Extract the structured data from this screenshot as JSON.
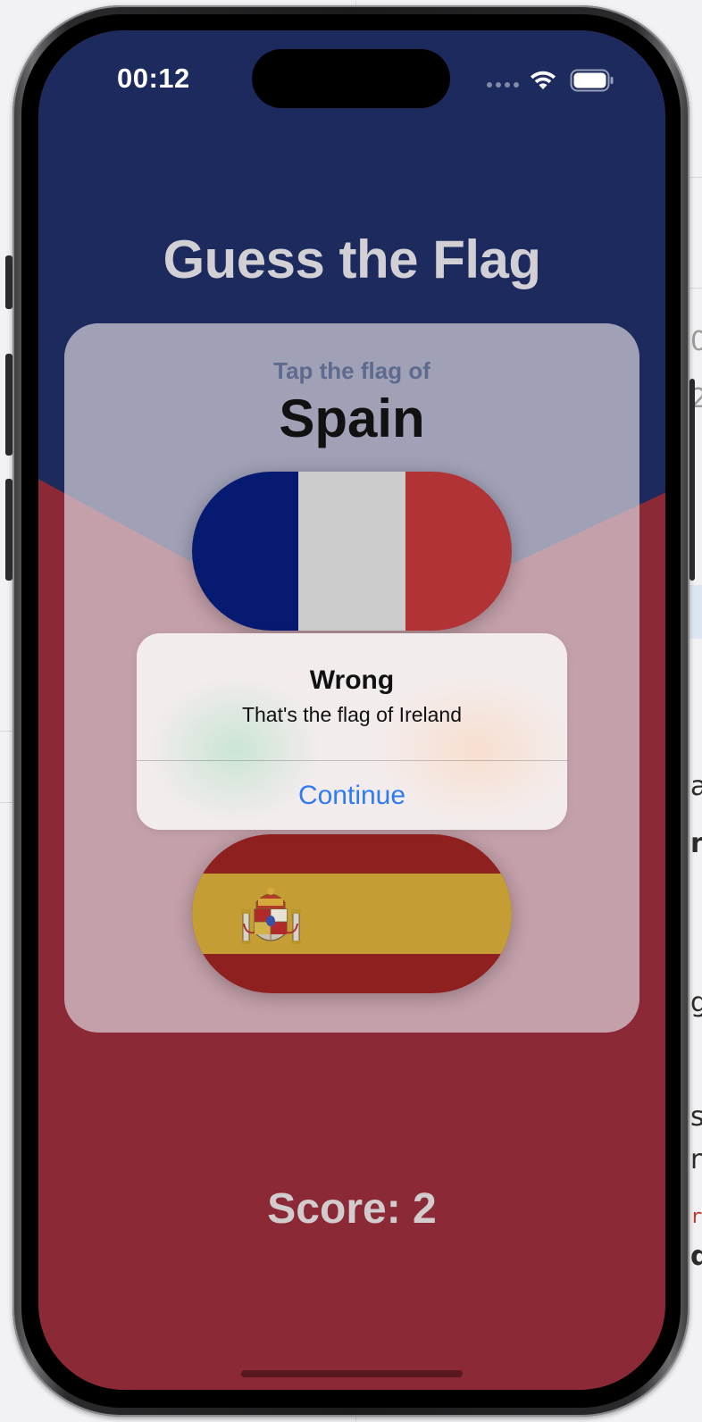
{
  "status_bar": {
    "time": "00:12"
  },
  "app": {
    "title": "Guess the Flag",
    "prompt_label": "Tap the flag of",
    "target_country": "Spain",
    "score_text": "Score: 2"
  },
  "flags": [
    {
      "country": "France",
      "colors": [
        "#071a72",
        "#cccccc",
        "#b13335"
      ]
    },
    {
      "country": "Spain",
      "colors": [
        "#8f2020",
        "#c49e34",
        "#8f2020"
      ]
    }
  ],
  "alert": {
    "title": "Wrong",
    "message": "That's the flag of Ireland",
    "button_label": "Continue"
  },
  "theme": {
    "top_background": "#1c2a5d",
    "bottom_background": "#8c2936",
    "accent": "#2f7bf0"
  }
}
